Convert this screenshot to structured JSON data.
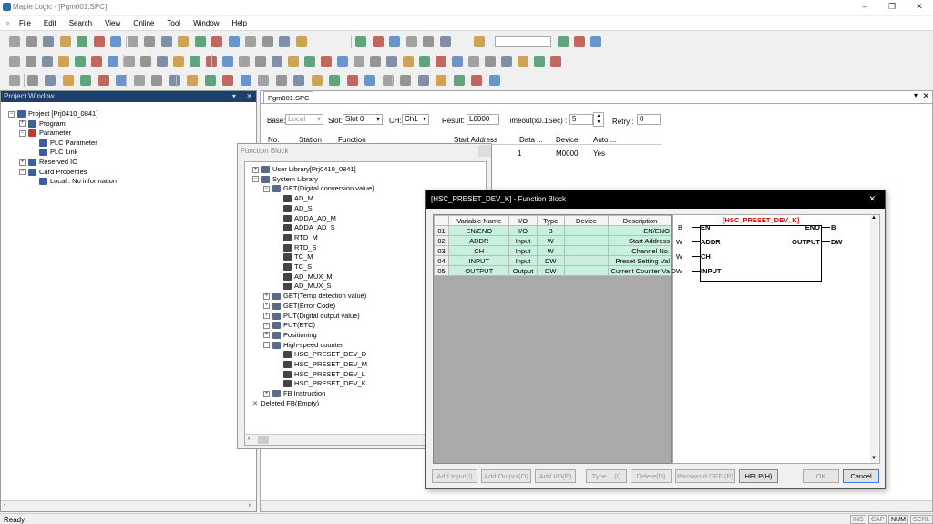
{
  "app": {
    "title": "Maple Logic - [Pgm001.SPC]"
  },
  "menu": [
    "File",
    "Edit",
    "Search",
    "View",
    "Online",
    "Tool",
    "Window",
    "Help"
  ],
  "project_window": {
    "title": "Project Window",
    "tree": [
      {
        "label": "Project [Prj0410_0841]",
        "level": 0,
        "exp": "-",
        "color": "#3b5fa0"
      },
      {
        "label": "Program",
        "level": 1,
        "exp": "+",
        "color": "#3b5fa0"
      },
      {
        "label": "Parameter",
        "level": 1,
        "exp": "-",
        "color": "#c0392b"
      },
      {
        "label": "PLC Parameter",
        "level": 2,
        "exp": "",
        "color": "#3b5fa0"
      },
      {
        "label": "PLC Link",
        "level": 2,
        "exp": "",
        "color": "#3b5fa0"
      },
      {
        "label": "Reserved IO",
        "level": 1,
        "exp": "+",
        "color": "#3b5fa0"
      },
      {
        "label": "Card Properties",
        "level": 1,
        "exp": "-",
        "color": "#3b5fa0"
      },
      {
        "label": "Local : No information",
        "level": 2,
        "exp": "",
        "color": "#3b5fa0"
      }
    ]
  },
  "doc_tab": "Pgm001.SPC",
  "main": {
    "base_label": "Base:",
    "base_value": "Local",
    "slot_label": "Slot:",
    "slot_value": "Slot 0",
    "ch_label": "CH:",
    "ch_value": "Ch1",
    "result_label": "Result:",
    "result_value": "L0000",
    "timeout_label": "Timeout(x0.1Sec) :",
    "timeout_value": "5",
    "retry_label": "Retry :",
    "retry_value": "0",
    "columns": [
      "No.",
      "Station",
      "Function",
      "Start Address",
      "Data ...",
      "Device",
      "Auto ..."
    ],
    "row": {
      "data": "1",
      "device": "M0000",
      "auto": "Yes"
    }
  },
  "fb_window": {
    "title": "Function Block",
    "tree": [
      {
        "label": "User Library[Prj0410_0841]",
        "level": 0,
        "exp": "+"
      },
      {
        "label": "System Library",
        "level": 0,
        "exp": "-"
      },
      {
        "label": "GET(Digital conversion value)",
        "level": 1,
        "exp": "-"
      },
      {
        "label": "AD_M",
        "level": 2,
        "exp": ""
      },
      {
        "label": "AD_S",
        "level": 2,
        "exp": ""
      },
      {
        "label": "ADDA_AD_M",
        "level": 2,
        "exp": ""
      },
      {
        "label": "ADDA_AD_S",
        "level": 2,
        "exp": ""
      },
      {
        "label": "RTD_M",
        "level": 2,
        "exp": ""
      },
      {
        "label": "RTD_S",
        "level": 2,
        "exp": ""
      },
      {
        "label": "TC_M",
        "level": 2,
        "exp": ""
      },
      {
        "label": "TC_S",
        "level": 2,
        "exp": ""
      },
      {
        "label": "AD_MUX_M",
        "level": 2,
        "exp": ""
      },
      {
        "label": "AD_MUX_S",
        "level": 2,
        "exp": ""
      },
      {
        "label": "GET(Temp detection value)",
        "level": 1,
        "exp": "+"
      },
      {
        "label": "GET(Error Code)",
        "level": 1,
        "exp": "+"
      },
      {
        "label": "PUT(Digital output value)",
        "level": 1,
        "exp": "+"
      },
      {
        "label": "PUT(ETC)",
        "level": 1,
        "exp": "+"
      },
      {
        "label": "Positioning",
        "level": 1,
        "exp": "+"
      },
      {
        "label": "High-speed counter",
        "level": 1,
        "exp": "-"
      },
      {
        "label": "HSC_PRESET_DEV_D",
        "level": 2,
        "exp": ""
      },
      {
        "label": "HSC_PRESET_DEV_M",
        "level": 2,
        "exp": ""
      },
      {
        "label": "HSC_PRESET_DEV_L",
        "level": 2,
        "exp": ""
      },
      {
        "label": "HSC_PRESET_DEV_K",
        "level": 2,
        "exp": ""
      },
      {
        "label": "FB Instruction",
        "level": 1,
        "exp": "+"
      },
      {
        "label": "Deleted FB(Empty)",
        "level": 0,
        "exp": "x"
      }
    ]
  },
  "dialog": {
    "title": "[HSC_PRESET_DEV_K] - Function Block",
    "close": "✕",
    "columns": [
      "",
      "Variable Name",
      "I/O",
      "Type",
      "Device",
      "Description"
    ],
    "rows": [
      {
        "no": "01",
        "name": "EN/ENO",
        "io": "I/O",
        "type": "B",
        "device": "",
        "desc": "EN/ENO"
      },
      {
        "no": "02",
        "name": "ADDR",
        "io": "Input",
        "type": "W",
        "device": "",
        "desc": "Start Address"
      },
      {
        "no": "03",
        "name": "CH",
        "io": "Input",
        "type": "W",
        "device": "",
        "desc": "Channel No."
      },
      {
        "no": "04",
        "name": "INPUT",
        "io": "Input",
        "type": "DW",
        "device": "",
        "desc": "Preset Setting Val"
      },
      {
        "no": "05",
        "name": "OUTPUT",
        "io": "Output",
        "type": "DW",
        "device": "",
        "desc": "Current Counter Va"
      }
    ],
    "block": {
      "name": "[HSC_PRESET_DEV_K]",
      "left_pins": [
        {
          "type": "B",
          "pin": "EN"
        },
        {
          "type": "W",
          "pin": "ADDR"
        },
        {
          "type": "W",
          "pin": "CH"
        },
        {
          "type": "DW",
          "pin": "INPUT"
        }
      ],
      "right_pins": [
        {
          "type": "B",
          "pin": "ENO"
        },
        {
          "type": "DW",
          "pin": "OUTPUT"
        }
      ]
    },
    "buttons": {
      "add_input": "Add Input(I)",
      "add_output": "Add Output(O)",
      "add_io": "Add I/O(E)",
      "type": "Type ...(I)",
      "delete": "Delete(D)",
      "password": "Password OFF (P)",
      "help": "HELP(H)",
      "ok": "OK",
      "cancel": "Cancel"
    }
  },
  "status": {
    "ready": "Ready",
    "ins": "INS",
    "cap": "CAP",
    "num": "NUM",
    "scrl": "SCRL"
  }
}
